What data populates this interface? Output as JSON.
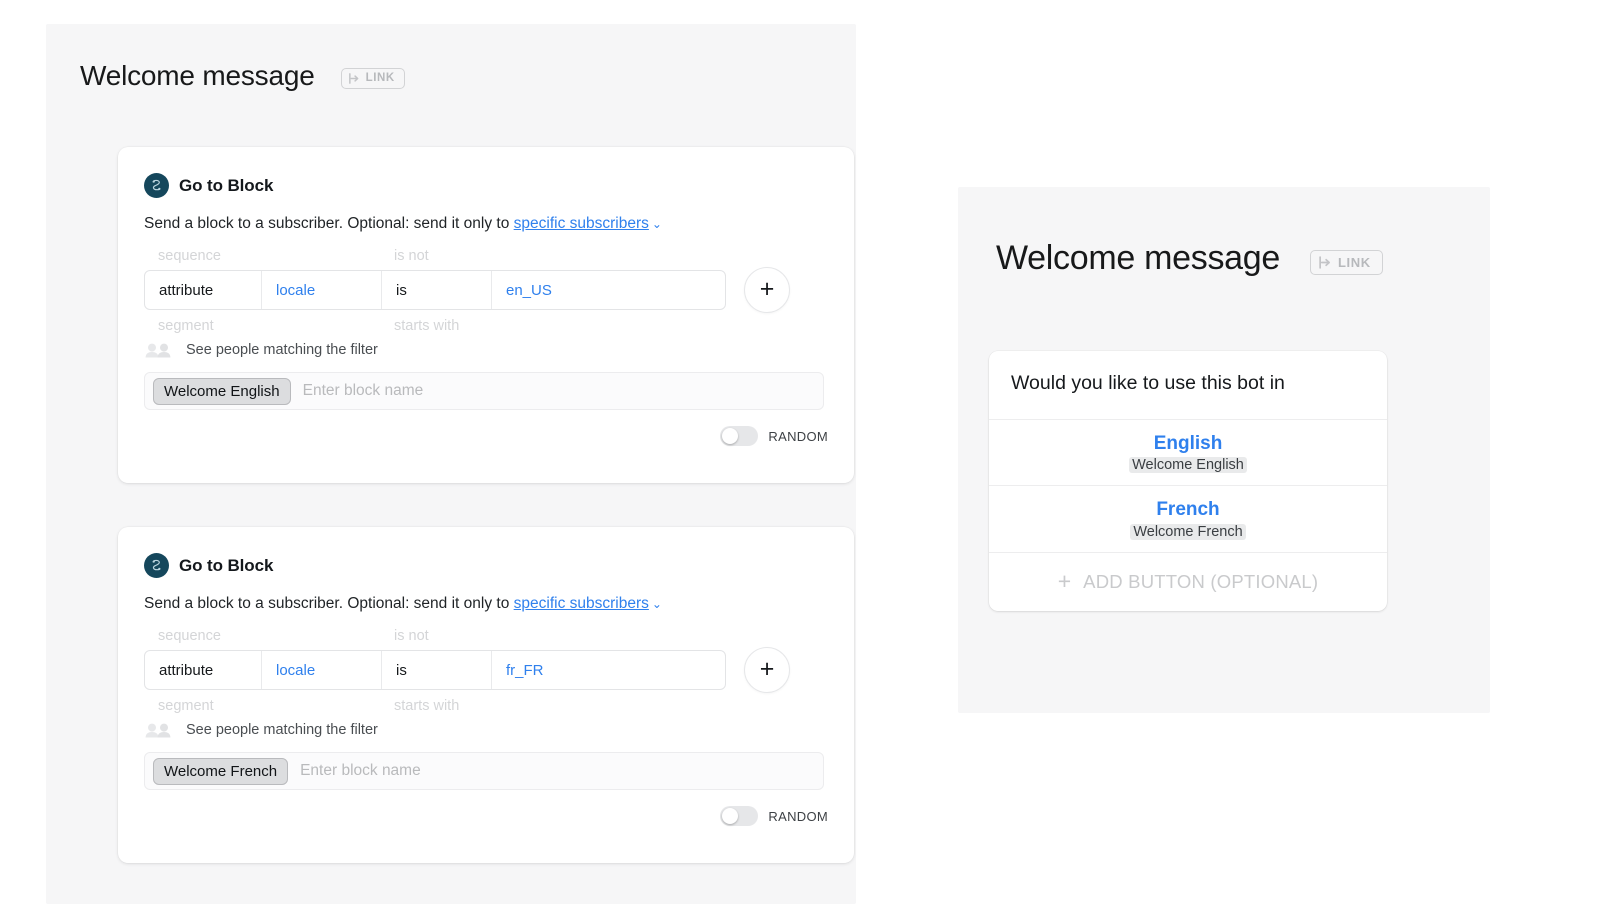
{
  "editor": {
    "title": "Welcome message",
    "link_badge": {
      "label": "LINK",
      "icon": "link-arrow-icon"
    },
    "cards": [
      {
        "icon": "go-to-block-icon",
        "heading": "Go to Block",
        "description_prefix": "Send a block to a subscriber. Optional: send it only to ",
        "description_link": "specific subscribers",
        "description_chevron": "⌄",
        "filter": {
          "ghost_above_left": "sequence",
          "ghost_above_right": "is not",
          "ghost_below_left": "segment",
          "ghost_below_right": "starts with",
          "type": "attribute",
          "key": "locale",
          "operator": "is",
          "value": "en_US",
          "add_label": "+"
        },
        "people_link": "See people matching the filter",
        "block_chip": "Welcome English",
        "block_placeholder": "Enter block name",
        "random_label": "RANDOM",
        "random_on": false
      },
      {
        "icon": "go-to-block-icon",
        "heading": "Go to Block",
        "description_prefix": "Send a block to a subscriber. Optional: send it only to ",
        "description_link": "specific subscribers",
        "description_chevron": "⌄",
        "filter": {
          "ghost_above_left": "sequence",
          "ghost_above_right": "is not",
          "ghost_below_left": "segment",
          "ghost_below_right": "starts with",
          "type": "attribute",
          "key": "locale",
          "operator": "is",
          "value": "fr_FR",
          "add_label": "+"
        },
        "people_link": "See people matching the filter",
        "block_chip": "Welcome French",
        "block_placeholder": "Enter block name",
        "random_label": "RANDOM",
        "random_on": false
      }
    ]
  },
  "preview": {
    "title": "Welcome message",
    "link_badge": {
      "label": "LINK",
      "icon": "link-arrow-icon"
    },
    "message_text": "Would you like to use this bot in",
    "buttons": [
      {
        "title": "English",
        "subtitle": "Welcome English"
      },
      {
        "title": "French",
        "subtitle": "Welcome French"
      }
    ],
    "add_button": {
      "plus": "+",
      "label": "ADD BUTTON (OPTIONAL)"
    }
  },
  "colors": {
    "accent_blue": "#2f80ed",
    "panel_bg": "#f6f6f7",
    "card_bg": "#ffffff",
    "icon_navy": "#15475c",
    "ghost_text": "#d4d5d7"
  }
}
